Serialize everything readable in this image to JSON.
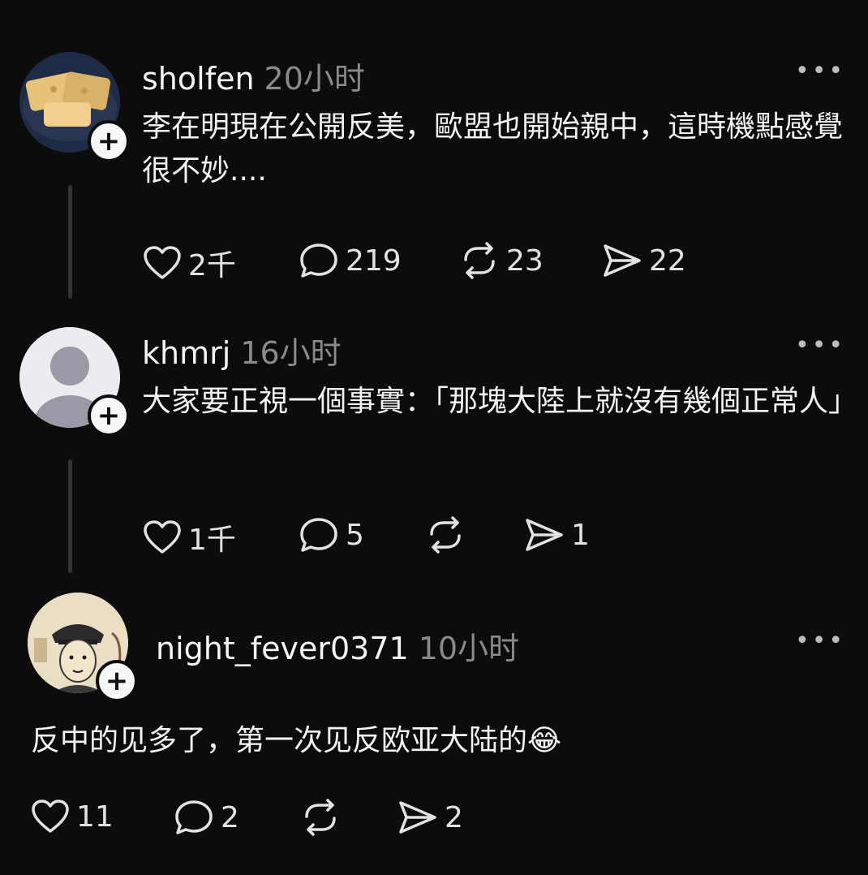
{
  "posts": [
    {
      "username": "sholfen",
      "time": "20小时",
      "text": "李在明現在公開反美，歐盟也開始親中，這時機點感覺很不妙....",
      "likes": "2千",
      "replies": "219",
      "reposts": "23",
      "shares": "22"
    },
    {
      "username": "khmrj",
      "time": "16小时",
      "text": "大家要正視一個事實：「那塊大陸上就沒有幾個正常人」",
      "likes": "1千",
      "replies": "5",
      "reposts": "",
      "shares": "1"
    },
    {
      "username": "night_fever0371",
      "time": "10小时",
      "text": "反中的见多了，第一次见反欧亚大陆的😂",
      "likes": "11",
      "replies": "2",
      "reposts": "",
      "shares": "2"
    }
  ],
  "icons": {
    "like": "heart-icon",
    "reply": "comment-bubble-icon",
    "repost": "repost-arrows-icon",
    "share": "send-paper-plane-icon",
    "more": "ellipsis-icon",
    "follow": "plus-icon"
  },
  "colors": {
    "background": "#0c0c0c",
    "text": "#f3f3f3",
    "muted": "#8a8a8a"
  }
}
